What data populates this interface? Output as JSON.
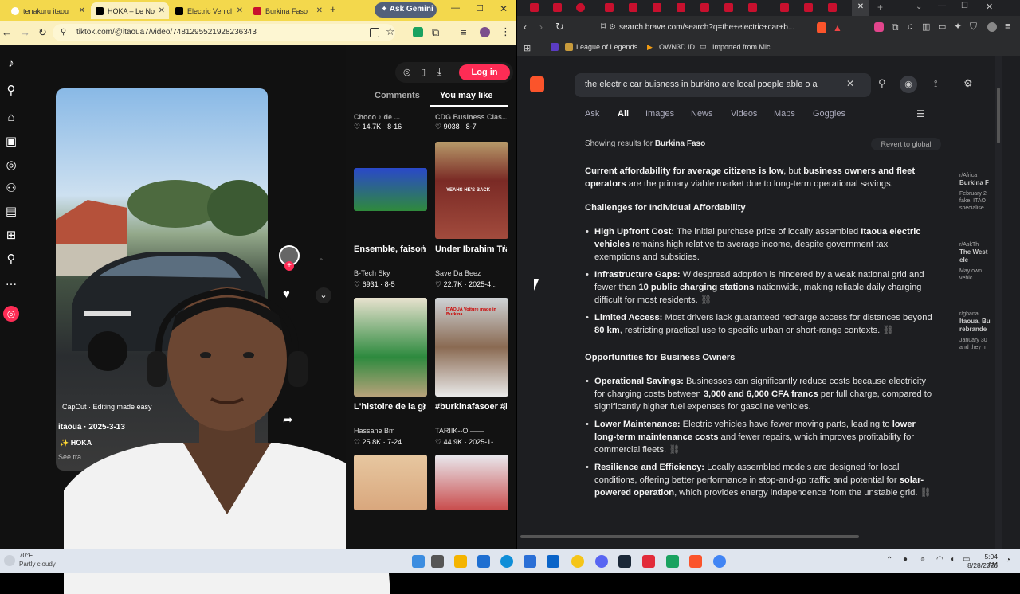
{
  "left_browser": {
    "tabs": [
      {
        "label": "tenakuru itaou",
        "color": "#ffffff"
      },
      {
        "label": "HOKA – Le No",
        "color": "#000000"
      },
      {
        "label": "Electric Vehicl",
        "color": "#000000"
      },
      {
        "label": "Burkina Faso",
        "color": "#c8102e"
      }
    ],
    "ask_gemini": "Ask Gemini",
    "url": "tiktok.com/@itaoua7/video/7481295521928236343"
  },
  "tiktok": {
    "login_label": "Log in",
    "tabs": [
      "Comments",
      "You may like"
    ],
    "capcut_label": "CapCut · Editing made easy",
    "author": "itaoua · 2025-3-13",
    "hoka": "✨ HOKA",
    "see_translation": "See tra",
    "top_row": [
      {
        "title": "Choco ♪ de ...",
        "stats": "♡ 14.7K · 8-16"
      },
      {
        "title": "CDG Business Clas...",
        "stats": "♡ 9038 · 8-7"
      }
    ],
    "videos": [
      {
        "title": "Ensemble, faisons avance...",
        "author": "B-Tech Sky",
        "stats": "♡ 6931 · 8-5",
        "thumb_text": ""
      },
      {
        "title": "Under Ibrahim Traoré, Burkina...",
        "author": "Save Da Beez",
        "stats": "♡ 22.7K · 2025-4...",
        "thumb_text": "YEAHS HE'S BACK"
      },
      {
        "title": "L'histoire de la grande mosqu...",
        "author": "Hassane Bm",
        "stats": "♡ 25.8K · 7-24",
        "thumb_text": ""
      },
      {
        "title": "#burkinafasoer #burkinatiktok...",
        "author": "TARIIK--O ——",
        "stats": "♡ 44.9K · 2025-1-...",
        "thumb_text": "ITAOUA Voiture made in Burkina"
      }
    ]
  },
  "right_browser": {
    "url": "search.brave.com/search?q=the+electric+car+b...",
    "bookmarks": [
      "League of Legends...",
      "OWN3D ID",
      "Imported from Mic..."
    ],
    "query": "the electric car buisness in burkino are  local poeple able o a",
    "search_tabs": [
      "Ask",
      "All",
      "Images",
      "News",
      "Videos",
      "Maps",
      "Goggles"
    ],
    "active_tab": "All",
    "showing_prefix": "Showing results for",
    "showing_place": "Burkina Faso",
    "revert": "Revert to global",
    "intro_bold_1": "Current affordability for average citizens is low",
    "intro_mid": ", but ",
    "intro_bold_2": "business owners and fleet operators",
    "intro_end": " are the primary viable market due to long-term operational savings.",
    "h1": "Challenges for Individual Affordability",
    "c1_head": "High Upfront Cost:",
    "c1_a": " The initial purchase price of locally assembled ",
    "c1_bold": "Itaoua electric vehicles",
    "c1_b": " remains high relative to average income, despite government tax exemptions and subsidies.",
    "c2_head": "Infrastructure Gaps:",
    "c2_a": " Widespread adoption is hindered by a weak national grid and fewer than ",
    "c2_bold": "10 public charging stations",
    "c2_b": " nationwide, making reliable daily charging difficult for most residents.",
    "c3_head": "Limited Access:",
    "c3_a": " Most drivers lack guaranteed recharge access for distances beyond ",
    "c3_bold": "80 km",
    "c3_b": ", restricting practical use to specific urban or short-range contexts.",
    "h2": "Opportunities for Business Owners",
    "o1_head": "Operational Savings:",
    "o1_a": " Businesses can significantly reduce costs because electricity for charging costs between ",
    "o1_bold": "3,000 and 6,000 CFA francs",
    "o1_b": " per full charge, compared to significantly higher fuel expenses for gasoline vehicles.",
    "o2_head": "Lower Maintenance:",
    "o2_a": " Electric vehicles have fewer moving parts, leading to ",
    "o2_bold": "lower long-term maintenance costs",
    "o2_b": " and fewer repairs, which improves profitability for commercial fleets.",
    "o3_head": "Resilience and Efficiency:",
    "o3_a": " Locally assembled models are designed for local conditions, offering better performance in stop-and-go traffic and potential for ",
    "o3_bold": "solar-powered operation",
    "o3_b": ", which provides energy independence from the unstable grid.",
    "side_cards": [
      {
        "source": "r/Africa",
        "title": "Burkina F",
        "meta": "February 2 fake. ITAO specialise"
      },
      {
        "source": "r/AskTh",
        "title": "The West ele",
        "meta": "May own vehic"
      },
      {
        "source": "r/ghana",
        "title": "Itaoua, Bu rebrande",
        "meta": "January 30 and they h"
      }
    ]
  },
  "taskbar": {
    "weather_temp": "70°F",
    "weather_desc": "Partly cloudy",
    "time": "5:04 AM",
    "date": "8/28/2026"
  }
}
